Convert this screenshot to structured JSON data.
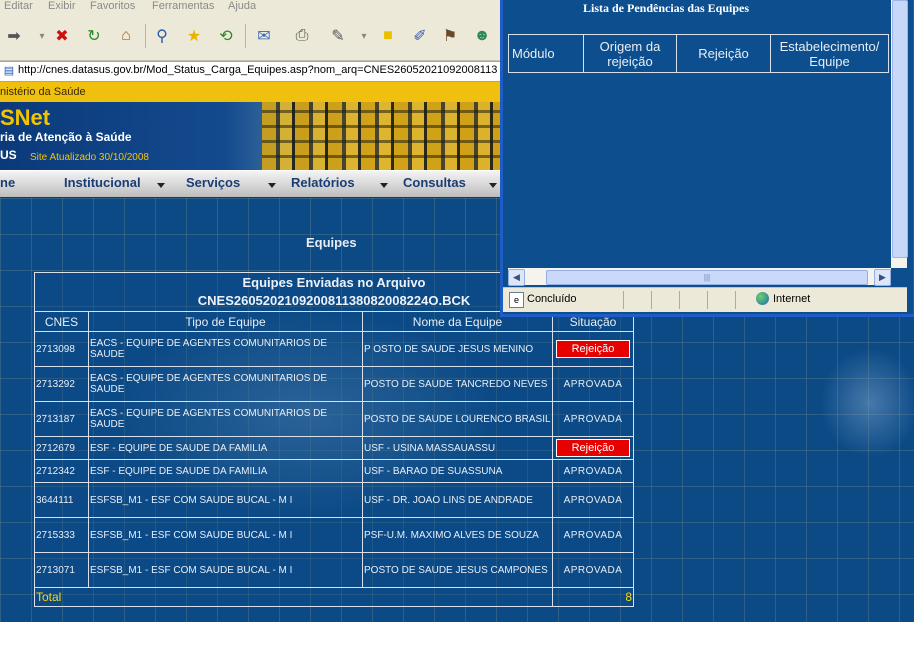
{
  "menu": [
    "Editar",
    "Exibir",
    "Favoritos",
    "Ferramentas",
    "Ajuda"
  ],
  "address": "http://cnes.datasus.gov.br/Mod_Status_Carga_Equipes.asp?nom_arq=CNES26052021092008113",
  "banner": {
    "ministry": "nistério da Saúde",
    "logo": "SNet",
    "subtitle": "ria de Atenção à Saúde",
    "us": "US",
    "updated": "Site Atualizado 30/10/2008"
  },
  "nav": [
    "ne",
    "Institucional",
    "Serviços",
    "Relatórios",
    "Consultas"
  ],
  "page": {
    "heading": "Equipes",
    "table_title_line1": "Equipes Enviadas no Arquivo",
    "table_title_line2": "CNES260520210920081138082008224O.BCK",
    "columns": [
      "CNES",
      "Tipo de Equipe",
      "Nome da Equipe",
      "Situação"
    ],
    "rows": [
      {
        "cnes": "2713098",
        "tipo": "EACS - EQUIPE DE AGENTES COMUNITARIOS DE SAUDE",
        "nome": "P OSTO DE SAUDE JESUS MENINO",
        "situacao": "Rejeição",
        "rejected": true
      },
      {
        "cnes": "2713292",
        "tipo": "EACS - EQUIPE DE AGENTES COMUNITARIOS DE SAUDE",
        "nome": "POSTO DE SAUDE TANCREDO NEVES",
        "situacao": "APROVADA",
        "rejected": false
      },
      {
        "cnes": "2713187",
        "tipo": "EACS - EQUIPE DE AGENTES COMUNITARIOS DE SAUDE",
        "nome": "POSTO DE SAUDE LOURENCO BRASIL",
        "situacao": "APROVADA",
        "rejected": false
      },
      {
        "cnes": "2712679",
        "tipo": "ESF - EQUIPE DE SAUDE DA FAMILIA",
        "nome": "USF - USINA MASSAUASSU",
        "situacao": "Rejeição",
        "rejected": true
      },
      {
        "cnes": "2712342",
        "tipo": "ESF - EQUIPE DE SAUDE DA FAMILIA",
        "nome": "USF - BARAO DE SUASSUNA",
        "situacao": "APROVADA",
        "rejected": false
      },
      {
        "cnes": "3644111",
        "tipo": "ESFSB_M1 - ESF COM SAUDE BUCAL - M I",
        "nome": "USF - DR. JOAO LINS DE ANDRADE",
        "situacao": "APROVADA",
        "rejected": false
      },
      {
        "cnes": "2715333",
        "tipo": "ESFSB_M1 - ESF COM SAUDE BUCAL - M I",
        "nome": "PSF-U.M. MAXIMO ALVES DE SOUZA",
        "situacao": "APROVADA",
        "rejected": false
      },
      {
        "cnes": "2713071",
        "tipo": "ESFSB_M1 - ESF COM SAUDE BUCAL - M I",
        "nome": "POSTO DE SAUDE JESUS CAMPONES",
        "situacao": "APROVADA",
        "rejected": false
      }
    ],
    "total_label": "Total",
    "total_value": "8"
  },
  "popup": {
    "title": "Lista de Pendências das Equipes",
    "columns": [
      "Módulo",
      "Origem da rejeição",
      "Rejeição",
      "Estabelecimento/ Equipe"
    ],
    "status_text": "Concluído",
    "zone_text": "Internet"
  },
  "colors": {
    "content_bg": "#0c4a86",
    "ministry_bar": "#f0c00e",
    "reject_badge": "#e60000",
    "total_text": "#ffd800"
  }
}
